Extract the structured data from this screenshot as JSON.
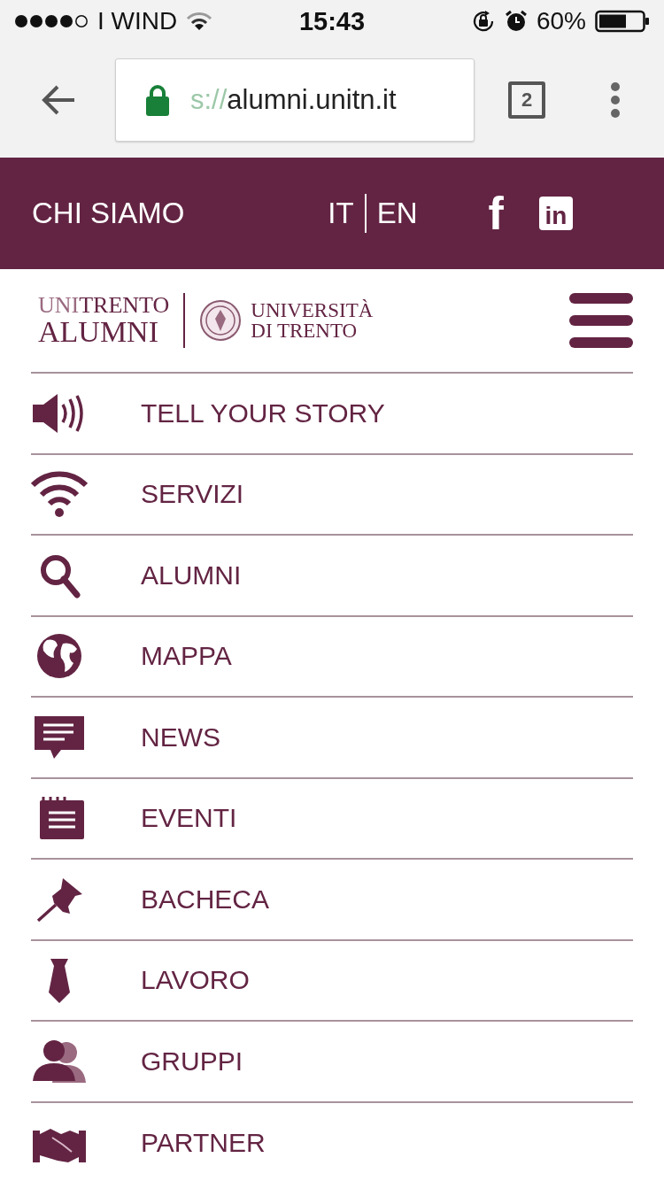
{
  "status_bar": {
    "carrier": "I WIND",
    "time": "15:43",
    "battery": "60%"
  },
  "browser": {
    "url_scheme": "s://",
    "url_host": "alumni.unitn.it",
    "tab_count": "2"
  },
  "header": {
    "about": "CHI SIAMO",
    "languages": [
      "IT",
      "EN"
    ],
    "facebook": "f",
    "linkedin": "in"
  },
  "logo": {
    "prefix": "UNI",
    "name": "TRENTO",
    "subtitle": "ALUMNI",
    "university": [
      "UNIVERSITÀ",
      "DI TRENTO"
    ]
  },
  "menu": [
    {
      "kind": "speaker",
      "label": "TELL YOUR STORY"
    },
    {
      "kind": "wifi",
      "label": "SERVIZI"
    },
    {
      "kind": "search",
      "label": "ALUMNI"
    },
    {
      "kind": "globe",
      "label": "MAPPA"
    },
    {
      "kind": "chat",
      "label": "NEWS"
    },
    {
      "kind": "notepad",
      "label": "EVENTI"
    },
    {
      "kind": "pin",
      "label": "BACHECA"
    },
    {
      "kind": "tie",
      "label": "LAVORO"
    },
    {
      "kind": "people",
      "label": "GRUPPI"
    },
    {
      "kind": "handshake",
      "label": "PARTNER"
    }
  ]
}
